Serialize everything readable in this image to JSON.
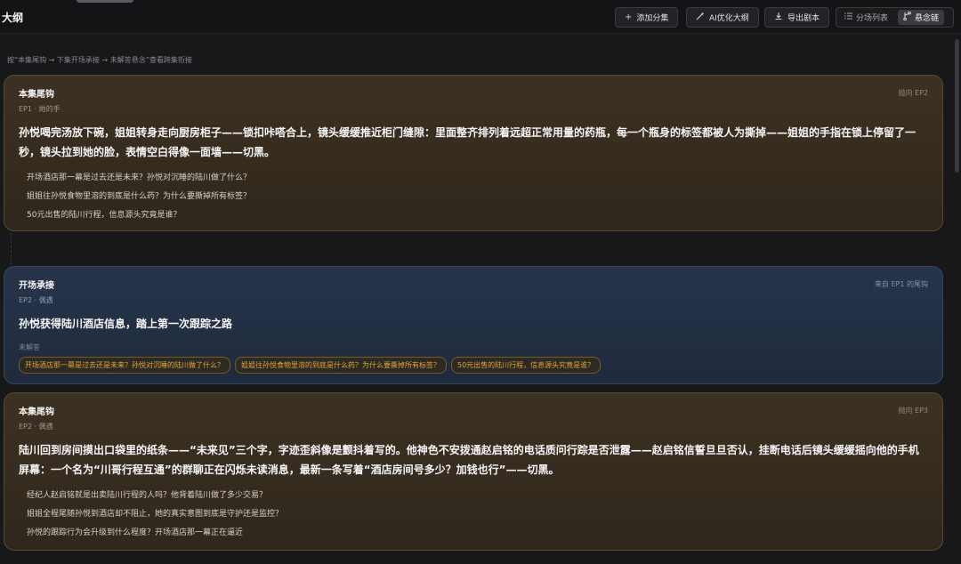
{
  "header": {
    "title": "大纲",
    "buttons": [
      {
        "icon": "plus-icon",
        "label": "添加分集"
      },
      {
        "icon": "magic-wand-icon",
        "label": "AI优化大纲"
      },
      {
        "icon": "download-icon",
        "label": "导出剧本"
      }
    ],
    "view_toggle": [
      {
        "icon": "list-icon",
        "label": "分场列表",
        "active": false
      },
      {
        "icon": "branch-icon",
        "label": "悬念链",
        "active": true
      }
    ]
  },
  "hint": "按“本集尾钩 → 下集开场承接 → 未解答悬念”查看跨集衔接",
  "cards": [
    {
      "kind": "ending",
      "type_label": "本集尾钩",
      "subtitle": "EP1 · 她的手",
      "tag": "抛向 EP2",
      "body": "孙悦喝完汤放下碗，姐姐转身走向厨房柜子——锁扣咔嗒合上，镜头缓缓推近柜门缝隙：里面整齐排列着远超正常用量的药瓶，每一个瓶身的标签都被人为撕掉——姐姐的手指在锁上停留了一秒，镜头拉到她的脸，表情空白得像一面墙——切黑。",
      "questions": [
        "开场酒店那一幕是过去还是未来？孙悦对沉睡的陆川做了什么？",
        "姐姐往孙悦食物里溶的到底是什么药？为什么要撕掉所有标签？",
        "50元出售的陆川行程，信息源头究竟是谁？"
      ]
    },
    {
      "kind": "opening",
      "type_label": "开场承接",
      "subtitle": "EP2 · 偶遇",
      "tag": "来自 EP1 的尾钩",
      "body": "孙悦获得陆川酒店信息，踏上第一次跟踪之路",
      "unanswered_label": "未解答",
      "chips": [
        "开场酒店那一幕是过去还是未来？孙悦对沉睡的陆川做了什么？",
        "姐姐往孙悦食物里溶的到底是什么药？为什么要撕掉所有标签？",
        "50元出售的陆川行程，信息源头究竟是谁？"
      ]
    },
    {
      "kind": "ending",
      "type_label": "本集尾钩",
      "subtitle": "EP2 · 偶遇",
      "tag": "抛向 EP3",
      "body": "陆川回到房间摸出口袋里的纸条——“未来见”三个字，字迹歪斜像是颤抖着写的。他神色不安拨通赵启铭的电话质问行踪是否泄露——赵启铭信誓旦旦否认，挂断电话后镜头缓缓摇向他的手机屏幕：一个名为“川哥行程互通”的群聊正在闪烁未读消息，最新一条写着“酒店房间号多少？加钱也行”——切黑。",
      "questions": [
        "经纪人赵启铭就是出卖陆川行程的人吗？他背着陆川做了多少交易？",
        "姐姐全程尾随孙悦到酒店却不阻止，她的真实意图到底是守护还是监控？",
        "孙悦的跟踪行为会升级到什么程度？开场酒店那一幕正在逼近"
      ]
    }
  ]
}
